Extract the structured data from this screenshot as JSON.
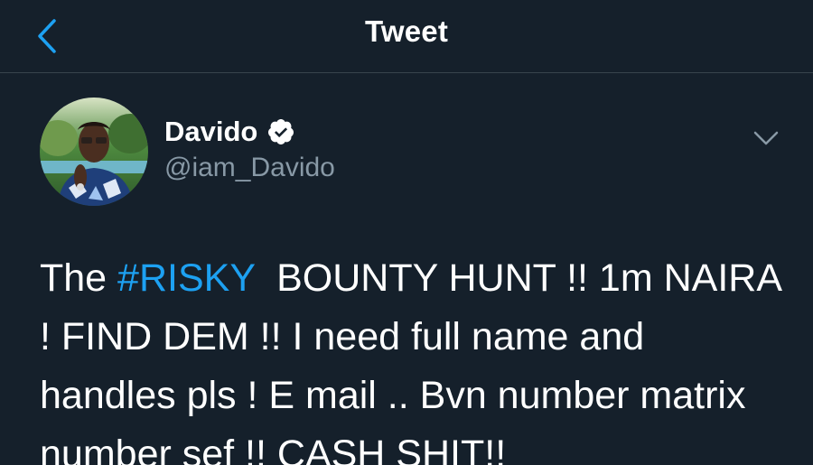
{
  "header": {
    "back_icon": "chevron-left-icon",
    "title": "Tweet"
  },
  "colors": {
    "background": "#15202b",
    "accent": "#1da1f2",
    "secondary_text": "#8899a6",
    "divider": "#38444d"
  },
  "tweet": {
    "author": {
      "display_name": "Davido",
      "verified_icon": "verified-badge-icon",
      "handle": "@iam_Davido"
    },
    "menu_icon": "chevron-down-icon",
    "text_before": "The ",
    "hashtag": "#RISKY",
    "text_after": "  BOUNTY HUNT !! 1m NAIRA ! FIND DEM !! I need full name and handles pls ! E mail .. Bvn number matrix number sef !! CASH SHIT!!"
  }
}
